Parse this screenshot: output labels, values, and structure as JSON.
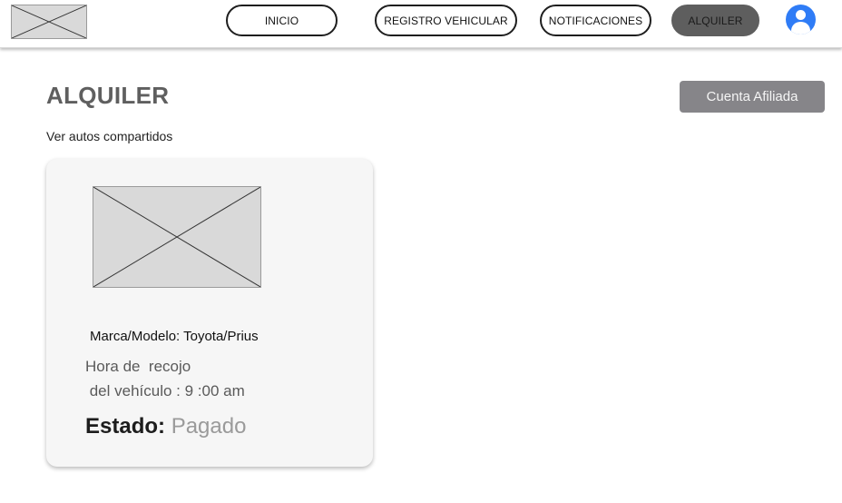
{
  "nav": {
    "logo_icon": "placeholder-image-icon",
    "items": [
      {
        "label": "INICIO",
        "active": false
      },
      {
        "label": "REGISTRO VEHICULAR",
        "active": false
      },
      {
        "label": "NOTIFICACIONES",
        "active": false
      },
      {
        "label": "ALQUILER",
        "active": true
      }
    ],
    "avatar_icon": "user-avatar-icon"
  },
  "page": {
    "title": "ALQUILER",
    "subtitle": "Ver autos compartidos",
    "affiliate_button": "Cuenta Afiliada"
  },
  "card": {
    "image_icon": "placeholder-image-icon",
    "model": "Marca/Modelo: Toyota/Prius",
    "pickup_line1": "Hora de  recojo",
    "pickup_line2": " del vehículo : 9 :00 am",
    "status_label": "Estado:",
    "status_value": "Pagado"
  },
  "colors": {
    "active_nav": "#5e5e5e",
    "affiliate_button": "#868589",
    "avatar": "#2f7cf6",
    "title": "#5f5f5f"
  }
}
